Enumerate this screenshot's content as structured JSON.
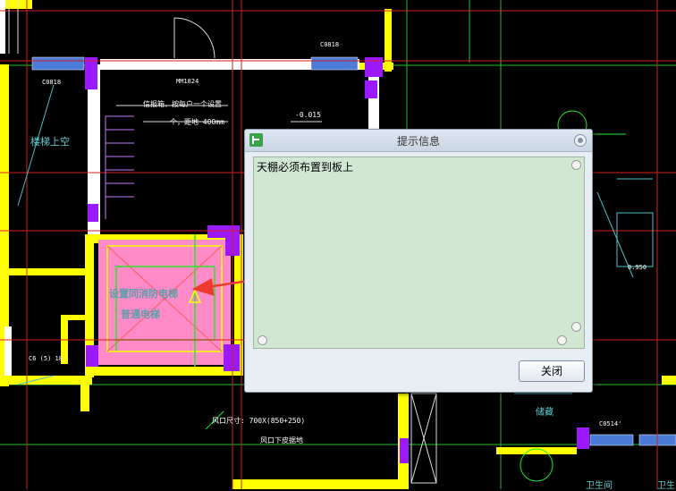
{
  "drawing": {
    "labels": {
      "door_top": "C0818",
      "door_left": "C0818",
      "window_code": "MM1824",
      "note_line1": "信报箱，按每户一个设置",
      "note_line2": "个，距地 400mm",
      "level": "-0.015",
      "stair_void": "楼梯上空",
      "elevator_fire": "设置同消防电梯",
      "elevator_normal": "普通电梯",
      "dim_left": "C6 (5) 18",
      "level_right": "0.950",
      "vent_size": "风口尺寸:   700X(850+250)",
      "vent_bottom": "风口下皮据地",
      "room_right": "储藏",
      "code_bottom": "C0514'",
      "bathroom": "卫生间",
      "bathroom2": "卫生"
    },
    "colors": {
      "background": "#000000",
      "wall_yellow": "#ffff00",
      "elevator_fill": "#ff88c8",
      "purple": "#9b19ff",
      "red_grid": "#d01a1a",
      "green_line": "#22e822",
      "cyan": "#5ecbd0"
    }
  },
  "dialog": {
    "title": "提示信息",
    "message": "天棚必须布置到板上",
    "close_button": "关闭",
    "icons": [
      "app-icon",
      "dialog-close-icon"
    ],
    "colors": {
      "message_bg": "#d0e8d2",
      "title_bg": "#d4dfeb"
    }
  }
}
